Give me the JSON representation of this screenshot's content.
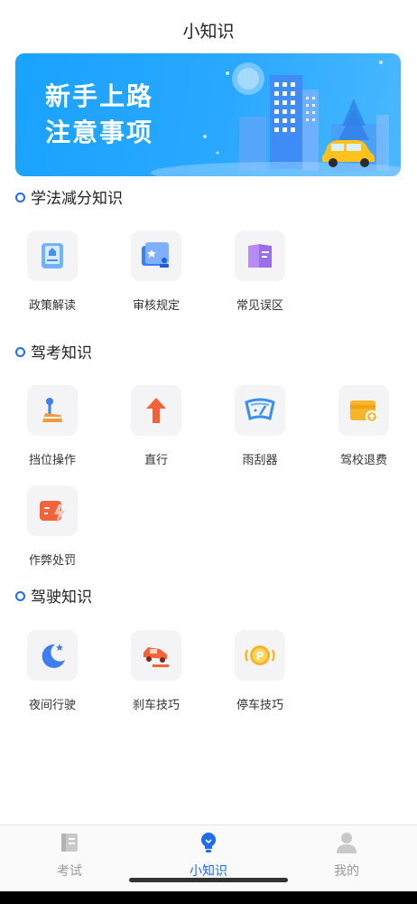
{
  "header": {
    "title": "小知识"
  },
  "banner": {
    "line1": "新手上路",
    "line2": "注意事项"
  },
  "sections": [
    {
      "title": "学法减分知识",
      "items": [
        {
          "label": "政策解读",
          "icon": "policy-document-icon"
        },
        {
          "label": "审核规定",
          "icon": "review-folder-icon"
        },
        {
          "label": "常见误区",
          "icon": "common-mistakes-book-icon"
        }
      ]
    },
    {
      "title": "驾考知识",
      "items": [
        {
          "label": "挡位操作",
          "icon": "gear-shift-icon"
        },
        {
          "label": "直行",
          "icon": "straight-arrow-icon"
        },
        {
          "label": "雨刮器",
          "icon": "wiper-icon"
        },
        {
          "label": "驾校退费",
          "icon": "refund-wallet-icon"
        },
        {
          "label": "作弊处罚",
          "icon": "cheating-penalty-icon"
        }
      ]
    },
    {
      "title": "驾驶知识",
      "items": [
        {
          "label": "夜间行驶",
          "icon": "night-moon-icon"
        },
        {
          "label": "刹车技巧",
          "icon": "braking-car-icon"
        },
        {
          "label": "停车技巧",
          "icon": "parking-icon"
        }
      ]
    }
  ],
  "bottom_nav": {
    "items": [
      {
        "label": "考试",
        "icon": "exam-book-icon",
        "active": false
      },
      {
        "label": "小知识",
        "icon": "lightbulb-icon",
        "active": true
      },
      {
        "label": "我的",
        "icon": "profile-person-icon",
        "active": false
      }
    ]
  },
  "colors": {
    "accent": "#1e6cf0",
    "banner": "#2aa8ff",
    "inactive": "#9a9a9a"
  }
}
